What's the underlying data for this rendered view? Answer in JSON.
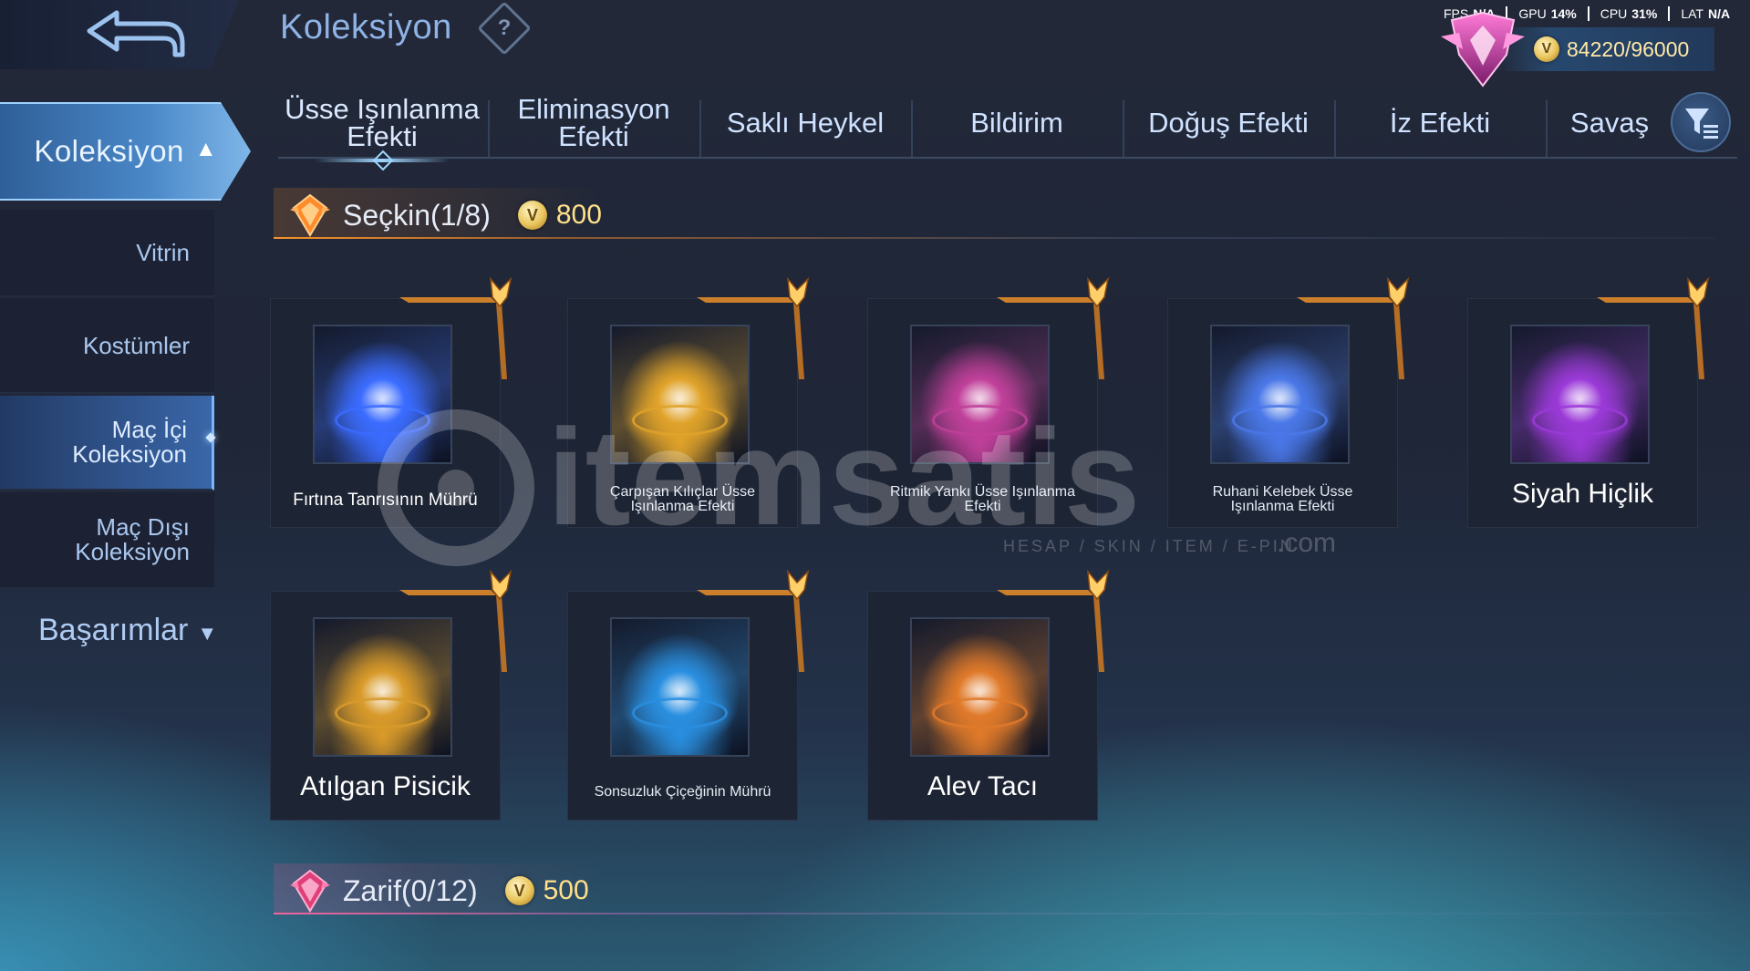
{
  "header": {
    "title": "Koleksiyon",
    "help_icon": "question-diamond-icon",
    "stats": [
      {
        "label": "FPS",
        "value": "N/A"
      },
      {
        "label": "GPU",
        "value": "14%"
      },
      {
        "label": "CPU",
        "value": "31%"
      },
      {
        "label": "LAT",
        "value": "N/A"
      }
    ],
    "currency": {
      "icon": "coin-icon",
      "amount": "84220/96000"
    }
  },
  "sidebar": {
    "active": {
      "label": "Koleksiyon",
      "icon": "chevron-up-icon"
    },
    "items": [
      {
        "label": "Vitrin"
      },
      {
        "label": "Kostümler"
      },
      {
        "label": "Maç İçi Koleksiyon",
        "line1": "Maç İçi",
        "line2": "Koleksiyon",
        "selected": true
      },
      {
        "label": "Maç Dışı Koleksiyon",
        "line1": "Maç Dışı",
        "line2": "Koleksiyon"
      }
    ],
    "achievements": {
      "label": "Başarımlar",
      "icon": "chevron-down-icon"
    }
  },
  "tabs": [
    {
      "label_line1": "Üsse Işınlanma",
      "label_line2": "Efekti",
      "active": true
    },
    {
      "label_line1": "Eliminasyon",
      "label_line2": "Efekti"
    },
    {
      "label_line1": "Saklı Heykel",
      "label_line2": ""
    },
    {
      "label_line1": "Bildirim",
      "label_line2": ""
    },
    {
      "label_line1": "Doğuş Efekti",
      "label_line2": ""
    },
    {
      "label_line1": "İz Efekti",
      "label_line2": ""
    },
    {
      "label_line1": "Savaş",
      "label_line2": ""
    }
  ],
  "filter_icon": "filter-icon",
  "sections": [
    {
      "title": "Seçkin(1/8)",
      "price": "800",
      "gem_color": "#ff8a2a",
      "items": [
        {
          "name": "Fırtına Tanrısının Mührü",
          "theme": "#3b6cff"
        },
        {
          "name": "Çarpışan Kılıçlar Üsse Işınlanma Efekti",
          "line1": "Çarpışan Kılıçlar Üsse",
          "line2": "Işınlanma Efekti",
          "theme": "#e0a32a"
        },
        {
          "name": "Ritmik Yankı Üsse Işınlanma Efekti",
          "line1": "Ritmik Yankı Üsse Işınlanma",
          "line2": "Efekti",
          "theme": "#c0409a"
        },
        {
          "name": "Ruhani Kelebek Üsse Işınlanma Efekti",
          "line1": "Ruhani Kelebek Üsse",
          "line2": "Işınlanma Efekti",
          "theme": "#4a78e8"
        },
        {
          "name": "Siyah Hiçlik",
          "theme": "#9b3ad8"
        },
        {
          "name": "Atılgan Pisicik",
          "theme": "#d89a2a"
        },
        {
          "name": "Sonsuzluk Çiçeğinin Mührü",
          "theme": "#2a8fe0"
        },
        {
          "name": "Alev Tacı",
          "theme": "#e07a2a"
        }
      ]
    },
    {
      "title": "Zarif(0/12)",
      "price": "500",
      "gem_color": "#e0407a"
    }
  ],
  "watermark": {
    "brand": "itemsatis",
    "tagline": "HESAP / SKIN / ITEM / E-PIN",
    "suffix": ".com"
  }
}
